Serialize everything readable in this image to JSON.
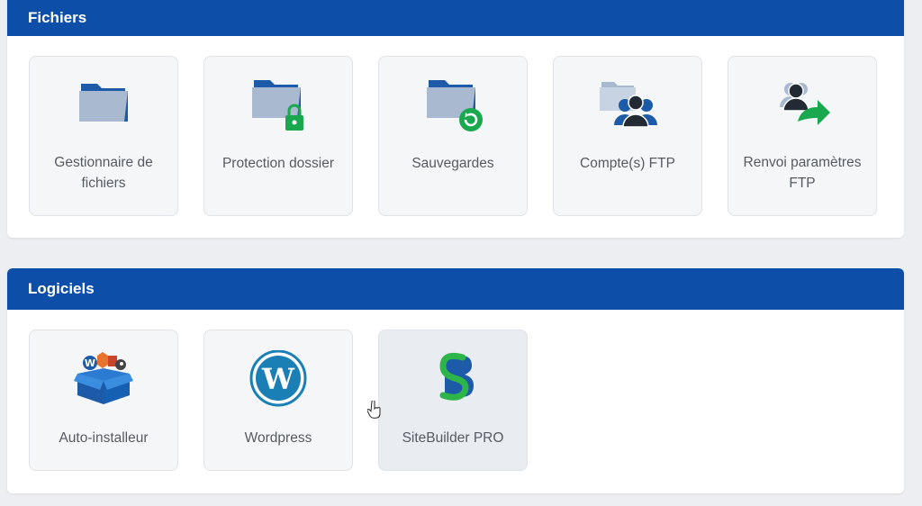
{
  "sections": {
    "files": {
      "title": "Fichiers",
      "tiles": [
        {
          "label": "Gestionnaire de fichiers",
          "icon": "folder-icon"
        },
        {
          "label": "Protection dossier",
          "icon": "folder-lock-icon"
        },
        {
          "label": "Sauvegardes",
          "icon": "folder-backup-icon"
        },
        {
          "label": "Compte(s) FTP",
          "icon": "ftp-accounts-icon"
        },
        {
          "label": "Renvoi paramètres FTP",
          "icon": "ftp-forward-icon"
        }
      ]
    },
    "software": {
      "title": "Logiciels",
      "tiles": [
        {
          "label": "Auto-installeur",
          "icon": "auto-installer-icon"
        },
        {
          "label": "Wordpress",
          "icon": "wordpress-icon"
        },
        {
          "label": "SiteBuilder PRO",
          "icon": "sitebuilder-icon"
        }
      ]
    }
  },
  "colors": {
    "header": "#0d4fa8",
    "folder_dark": "#1d5aa8",
    "folder_light": "#a9b9cf",
    "green": "#1aa84f"
  }
}
